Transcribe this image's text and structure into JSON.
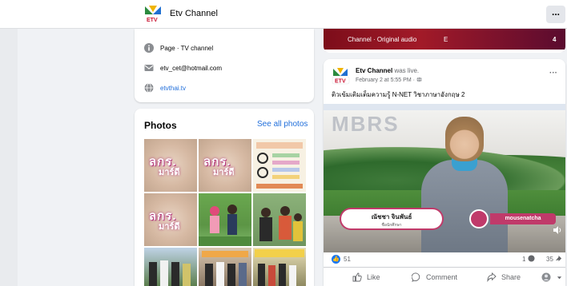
{
  "header": {
    "title": "Etv Channel",
    "more_label": "..."
  },
  "intro": {
    "page_type": "Page · TV channel",
    "email": "etv_cet@hotmail.com",
    "website": "etvthai.tv"
  },
  "photos": {
    "title": "Photos",
    "see_all": "See all photos",
    "thumb_caption_line1": "ลกร.",
    "thumb_caption_line2": "มาร์ดี"
  },
  "prev_post": {
    "audio_text": "Channel · Original audio",
    "letter": "E",
    "count": "4"
  },
  "post": {
    "author": "Etv Channel",
    "status": " was live.",
    "date": "February 2 at 5:55 PM · ",
    "menu": "···",
    "caption": "ติวเข้มเติมเต็มความรู้ N-NET วิชาภาษาอังกฤษ 2",
    "video": {
      "sign_text": "MBRS",
      "name_card": "ณัชชา จินพันธ์",
      "name_sub": "ชื่อนักศึกษา",
      "instagram": "mousenatcha"
    },
    "reactions": "51",
    "comments": "1",
    "shares": "35",
    "actions": {
      "like": "Like",
      "comment": "Comment",
      "share": "Share"
    }
  },
  "colors": {
    "brand_blue": "#1877f2",
    "link_blue": "#216fdb",
    "live_strip": "#a21a28",
    "ig_pink": "#c03a6a"
  }
}
